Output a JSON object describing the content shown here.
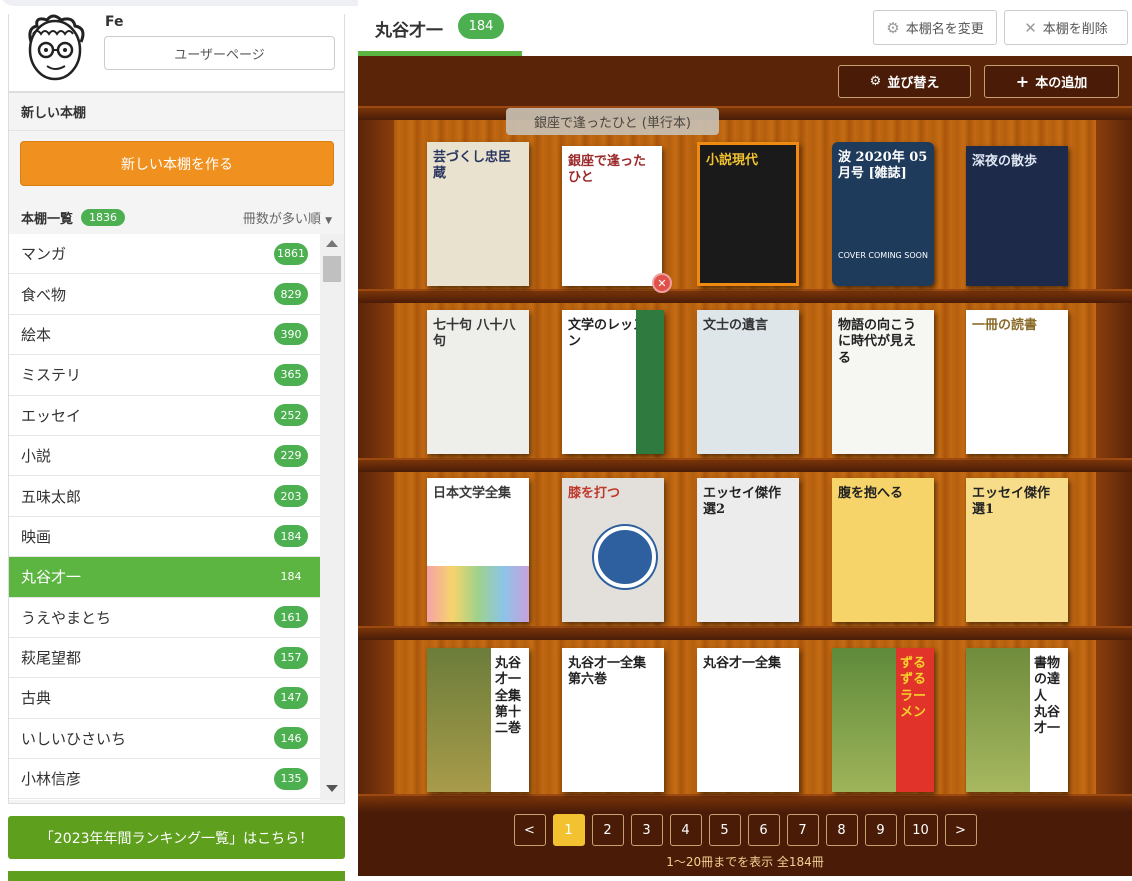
{
  "user": {
    "name": "Fe",
    "page_button": "ユーザーページ"
  },
  "sidebar": {
    "new_shelf_heading": "新しい本棚",
    "new_shelf_button": "新しい本棚を作る",
    "list_title": "本棚一覧",
    "list_count": "1836",
    "sort_label": "冊数が多い順",
    "shelves": [
      {
        "name": "マンガ",
        "count": "1861"
      },
      {
        "name": "食べ物",
        "count": "829"
      },
      {
        "name": "絵本",
        "count": "390"
      },
      {
        "name": "ミステリ",
        "count": "365"
      },
      {
        "name": "エッセイ",
        "count": "252"
      },
      {
        "name": "小説",
        "count": "229"
      },
      {
        "name": "五味太郎",
        "count": "203"
      },
      {
        "name": "映画",
        "count": "184"
      },
      {
        "name": "丸谷才一",
        "count": "184",
        "active": true
      },
      {
        "name": "うえやまとち",
        "count": "161"
      },
      {
        "name": "萩尾望都",
        "count": "157"
      },
      {
        "name": "古典",
        "count": "147"
      },
      {
        "name": "いしいひさいち",
        "count": "146"
      },
      {
        "name": "小林信彦",
        "count": "135"
      }
    ],
    "ranking_button": "「2023年年間ランキング一覧」はこちら！"
  },
  "header": {
    "title": "丸谷才一",
    "count": "184",
    "rename_button": "本棚名を変更",
    "delete_button": "本棚を削除"
  },
  "toolbar": {
    "sort_button": "並び替え",
    "add_button": "本の追加"
  },
  "tooltip": "銀座で逢ったひと (単行本)",
  "books": [
    {
      "title": "芸づくし忠臣蔵",
      "bg": "#e9e2cf",
      "fg": "#2a3560"
    },
    {
      "title": "銀座で逢ったひと",
      "bg": "#ffffff",
      "fg": "#9b2b2b"
    },
    {
      "title": "小説現代",
      "bg": "#1a1a1a",
      "fg": "#f2c230"
    },
    {
      "title": "波 2020年 05月号 [雑誌]",
      "bg": "#1f3b5c",
      "fg": "#ffffff",
      "note": "COVER COMING SOON"
    },
    {
      "title": "深夜の散歩",
      "bg": "#1d2a4a",
      "fg": "#dfe6f2"
    },
    {
      "title": "七十句 八十八句",
      "bg": "#eeeeea",
      "fg": "#333333"
    },
    {
      "title": "文学のレッスン",
      "bg": "#ffffff",
      "fg": "#222222"
    },
    {
      "title": "文士の遺言",
      "bg": "#dfe6ea",
      "fg": "#333333"
    },
    {
      "title": "物語の向こうに時代が見える",
      "bg": "#f6f6f2",
      "fg": "#222222"
    },
    {
      "title": "一冊の読書",
      "bg": "#ffffff",
      "fg": "#8a6b2a"
    },
    {
      "title": "日本文学全集",
      "bg": "#ffffff",
      "fg": "#3a3a3a"
    },
    {
      "title": "膝を打つ",
      "bg": "#e3dfdb",
      "fg": "#c0392b"
    },
    {
      "title": "エッセイ傑作選2",
      "bg": "#ececec",
      "fg": "#222222"
    },
    {
      "title": "腹を抱へる",
      "bg": "#f6d46a",
      "fg": "#222222"
    },
    {
      "title": "エッセイ傑作選1",
      "bg": "#f7dd8a",
      "fg": "#222222"
    },
    {
      "title": "丸谷才一全集 第十二巻",
      "bg": "#ffffff",
      "fg": "#222222"
    },
    {
      "title": "丸谷才一全集 第六巻",
      "bg": "#ffffff",
      "fg": "#222222"
    },
    {
      "title": "丸谷才一全集",
      "bg": "#ffffff",
      "fg": "#222222"
    },
    {
      "title": "ずるずるラーメン",
      "bg": "#e2332a",
      "fg": "#f6d22a"
    },
    {
      "title": "書物の達人 丸谷才一",
      "bg": "#ffffff",
      "fg": "#222222"
    }
  ],
  "pagination": {
    "prev": "<",
    "next": ">",
    "pages": [
      "1",
      "2",
      "3",
      "4",
      "5",
      "6",
      "7",
      "8",
      "9",
      "10"
    ],
    "current": "1",
    "summary": "1〜20冊までを表示 全184冊"
  }
}
